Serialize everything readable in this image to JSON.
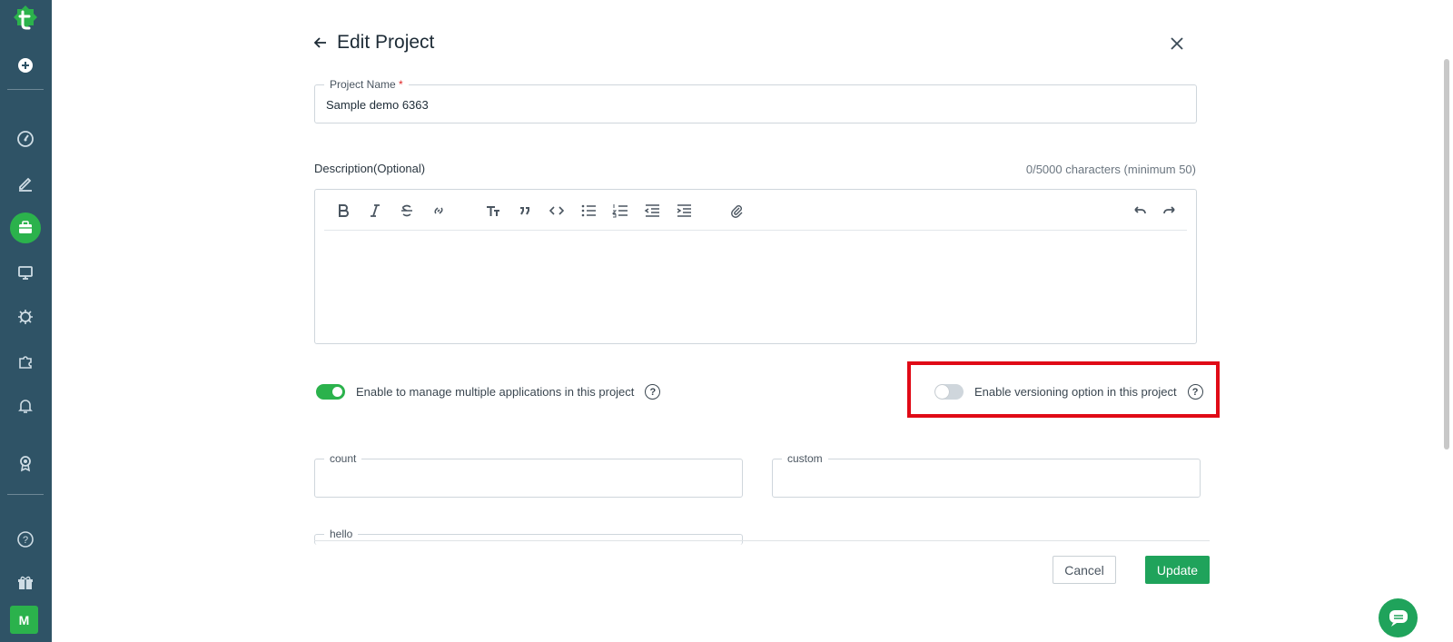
{
  "sidebar": {
    "items": [
      {
        "name": "create-icon"
      },
      {
        "name": "dashboard-icon"
      },
      {
        "name": "edit-icon"
      },
      {
        "name": "projects-icon",
        "active": true
      },
      {
        "name": "monitor-icon"
      },
      {
        "name": "bug-icon"
      },
      {
        "name": "integrations-icon"
      },
      {
        "name": "notifications-icon"
      },
      {
        "name": "badge-icon"
      },
      {
        "name": "help-icon"
      },
      {
        "name": "gift-icon"
      }
    ],
    "avatar_initial": "M",
    "accent": "#2bb24c",
    "background": "#2f5366"
  },
  "header": {
    "title": "Edit Project"
  },
  "form": {
    "project_name": {
      "label": "Project Name",
      "required_mark": "*",
      "value": "Sample demo 6363"
    },
    "description": {
      "label": "Description(Optional)",
      "char_count": "0/5000 characters (minimum 50)"
    },
    "toggles": {
      "multiple_apps": {
        "label": "Enable to manage multiple applications in this project",
        "on": true
      },
      "versioning": {
        "label": "Enable versioning option in this project",
        "on": false
      }
    },
    "custom_fields": [
      {
        "label": "count",
        "value": ""
      },
      {
        "label": "custom",
        "value": ""
      },
      {
        "label": "hello",
        "value": ""
      }
    ]
  },
  "buttons": {
    "cancel": "Cancel",
    "update": "Update"
  },
  "colors": {
    "primary": "#1fa35b",
    "highlight": "#e00a16"
  }
}
